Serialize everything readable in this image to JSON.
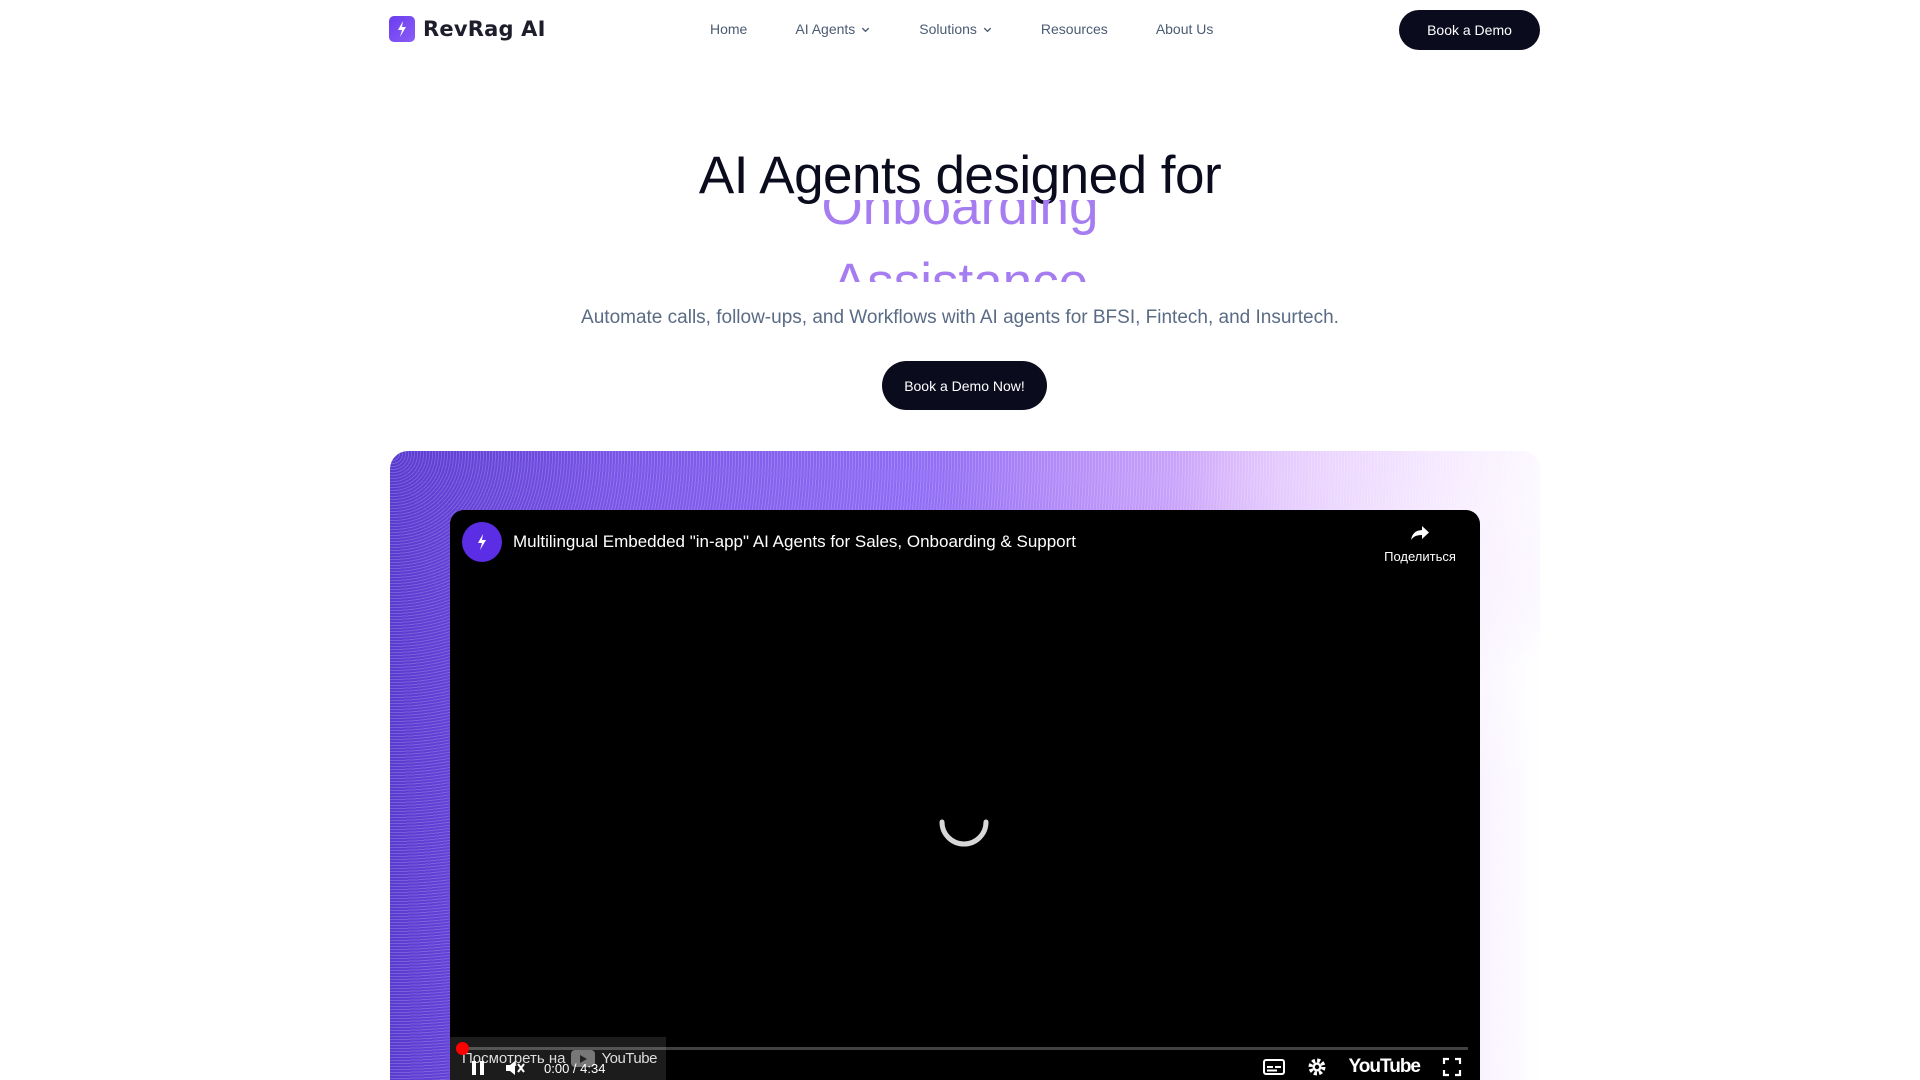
{
  "nav": {
    "brand": "RevRag AI",
    "items": [
      {
        "label": "Home"
      },
      {
        "label": "AI Agents"
      },
      {
        "label": "Solutions"
      },
      {
        "label": "Resources"
      },
      {
        "label": "About Us"
      }
    ],
    "cta_label": "Book a Demo"
  },
  "hero": {
    "title": "AI Agents designed for",
    "rotating_words": [
      "Onboarding",
      "Assistance"
    ],
    "subtitle": "Automate calls, follow-ups, and Workflows with AI agents for BFSI, Fintech, and Insurtech.",
    "cta_label": "Book a Demo Now!"
  },
  "video": {
    "title": "Multilingual Embedded \"in-app\" AI Agents for Sales, Onboarding & Support",
    "share_label": "Поделиться",
    "watch_on_label": "Посмотреть на",
    "watch_on_brand": "YouTube",
    "time": "0:00 / 4:34",
    "progress": 0.005,
    "brand_mark": "YouTube"
  },
  "colors": {
    "accent": "#a67df0",
    "dark": "#0b0b1e",
    "brand_purple": "#5b2ee6"
  }
}
